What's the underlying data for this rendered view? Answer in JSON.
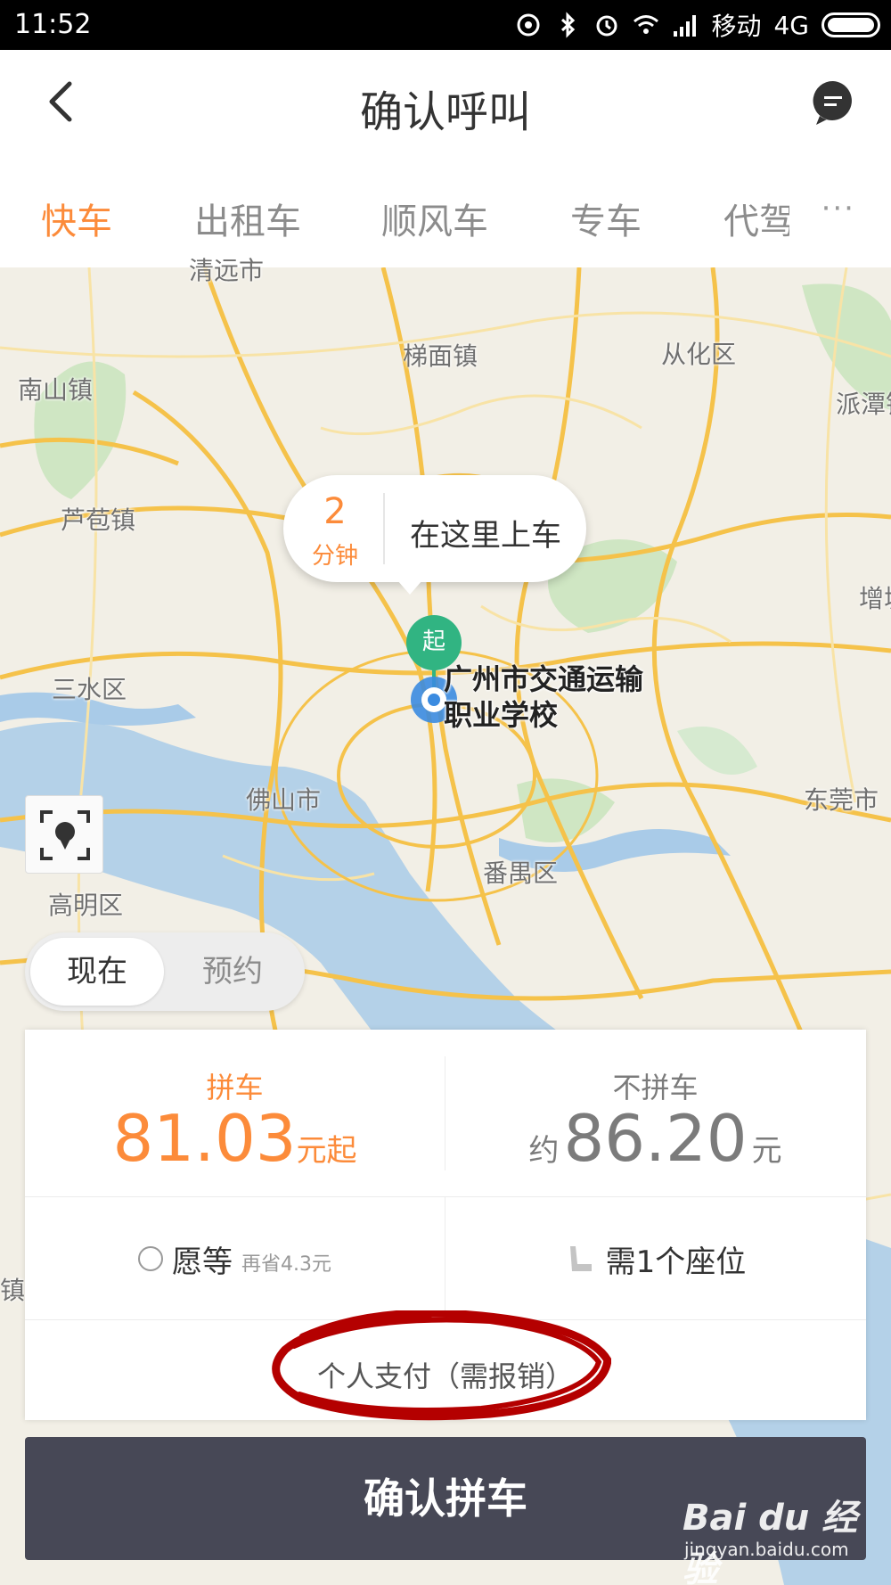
{
  "status_bar": {
    "time": "11:52",
    "carrier": "移动",
    "network": "4G"
  },
  "header": {
    "title": "确认呼叫",
    "back_icon": "back-arrow-icon",
    "message_icon": "message-icon"
  },
  "tabs": [
    {
      "label": "快车",
      "active": true
    },
    {
      "label": "出租车"
    },
    {
      "label": "顺风车"
    },
    {
      "label": "专车"
    },
    {
      "label": "代驾"
    }
  ],
  "tabs_more": "···",
  "map": {
    "places": [
      "清远市",
      "梯面镇",
      "从化区",
      "南山镇",
      "派潭镇",
      "芦苞镇",
      "增城",
      "三水区",
      "佛山市",
      "番禺区",
      "东莞市",
      "高明区",
      "镇"
    ],
    "eta": {
      "number": "2",
      "unit": "分钟",
      "text": "在这里上车"
    },
    "start_label": "起",
    "place_name_line1": "广州市交通运输",
    "place_name_line2": "职业学校"
  },
  "time_toggle": {
    "now": "现在",
    "reserve": "预约"
  },
  "fare": {
    "carpool_label": "拼车",
    "carpool_price": "81.03",
    "carpool_unit": "元起",
    "solo_label": "不拼车",
    "solo_prefix": "约",
    "solo_price": "86.20",
    "solo_unit": "元"
  },
  "options": {
    "wait_label": "愿等",
    "wait_sub": "再省4.3元",
    "seat_label": "需1个座位"
  },
  "payment": "个人支付（需报销）",
  "confirm_button": "确认拼车",
  "watermark": {
    "logo": "Bai du 经验",
    "url": "jingyan.baidu.com"
  },
  "colors": {
    "accent": "#fc8b3a",
    "button": "#474856",
    "start_marker": "#31b482",
    "annotation": "#b40000"
  }
}
